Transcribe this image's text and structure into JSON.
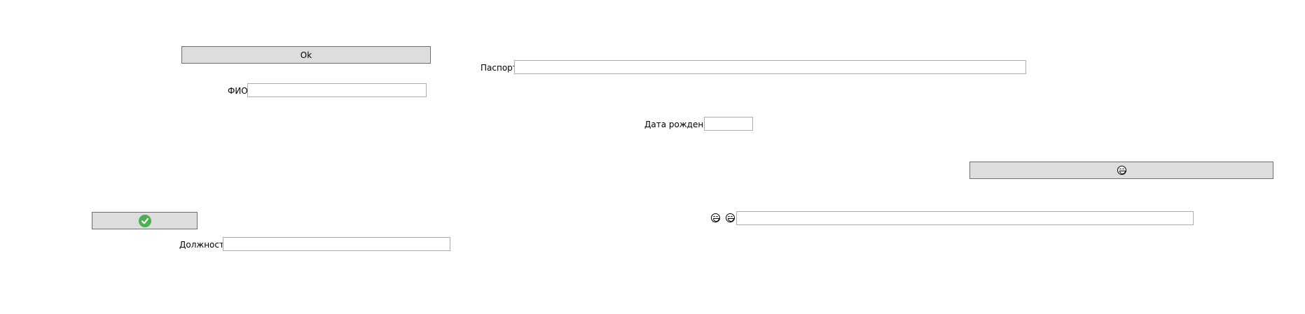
{
  "form": {
    "ok_button_label": "Ok",
    "fio_label": "ФИО",
    "fio_value": "",
    "passport_label": "Паспорт",
    "passport_value": "",
    "birthdate_label": "Дата рождения",
    "birthdate_value": "",
    "position_label": "Должность",
    "position_value": "",
    "emoji_input_value": ""
  },
  "icons": {
    "emoji_button_icon": "laughing-tears-face-icon",
    "check_button_icon": "green-check-icon",
    "emoji_label_icon_1": "laughing-tears-face-icon",
    "emoji_label_icon_2": "grinning-face-icon"
  },
  "colors": {
    "button_bg": "#dddddd",
    "button_border": "#707070",
    "field_border": "#abadb3",
    "check_green": "#4caf50"
  }
}
